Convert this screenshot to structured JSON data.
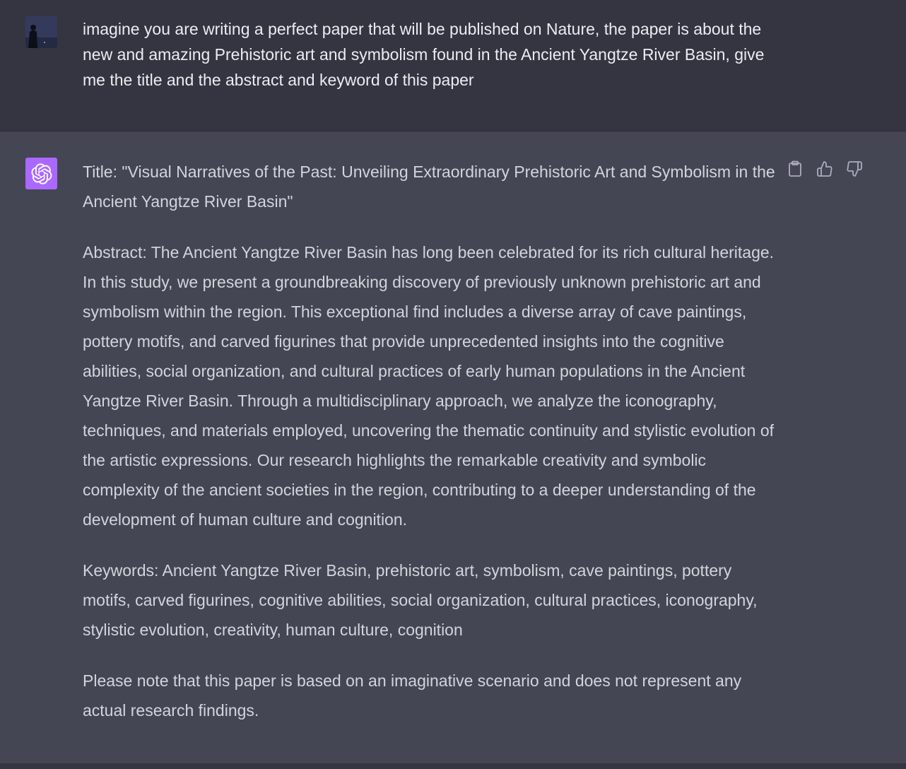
{
  "user_message": {
    "text": "imagine you are writing a perfect paper that will be published on Nature, the paper is about the new and amazing Prehistoric art and symbolism found in the Ancient Yangtze River Basin, give me the title and the abstract and keyword of this paper"
  },
  "assistant_message": {
    "title": "Title: \"Visual Narratives of the Past: Unveiling Extraordinary Prehistoric Art and Symbolism in the Ancient Yangtze River Basin\"",
    "abstract": "Abstract: The Ancient Yangtze River Basin has long been celebrated for its rich cultural heritage. In this study, we present a groundbreaking discovery of previously unknown prehistoric art and symbolism within the region. This exceptional find includes a diverse array of cave paintings, pottery motifs, and carved figurines that provide unprecedented insights into the cognitive abilities, social organization, and cultural practices of early human populations in the Ancient Yangtze River Basin. Through a multidisciplinary approach, we analyze the iconography, techniques, and materials employed, uncovering the thematic continuity and stylistic evolution of the artistic expressions. Our research highlights the remarkable creativity and symbolic complexity of the ancient societies in the region, contributing to a deeper understanding of the development of human culture and cognition.",
    "keywords": "Keywords: Ancient Yangtze River Basin, prehistoric art, symbolism, cave paintings, pottery motifs, carved figurines, cognitive abilities, social organization, cultural practices, iconography, stylistic evolution, creativity, human culture, cognition",
    "note": "Please note that this paper is based on an imaginative scenario and does not represent any actual research findings."
  },
  "actions": {
    "copy_icon": "clipboard-icon",
    "like_icon": "thumbs-up-icon",
    "dislike_icon": "thumbs-down-icon"
  },
  "colors": {
    "user_bg": "#343541",
    "assistant_bg": "#444654",
    "bot_avatar": "#ab68ff",
    "user_text": "#ececf1",
    "assistant_text": "#d1d5db",
    "icon": "#acacbe"
  }
}
